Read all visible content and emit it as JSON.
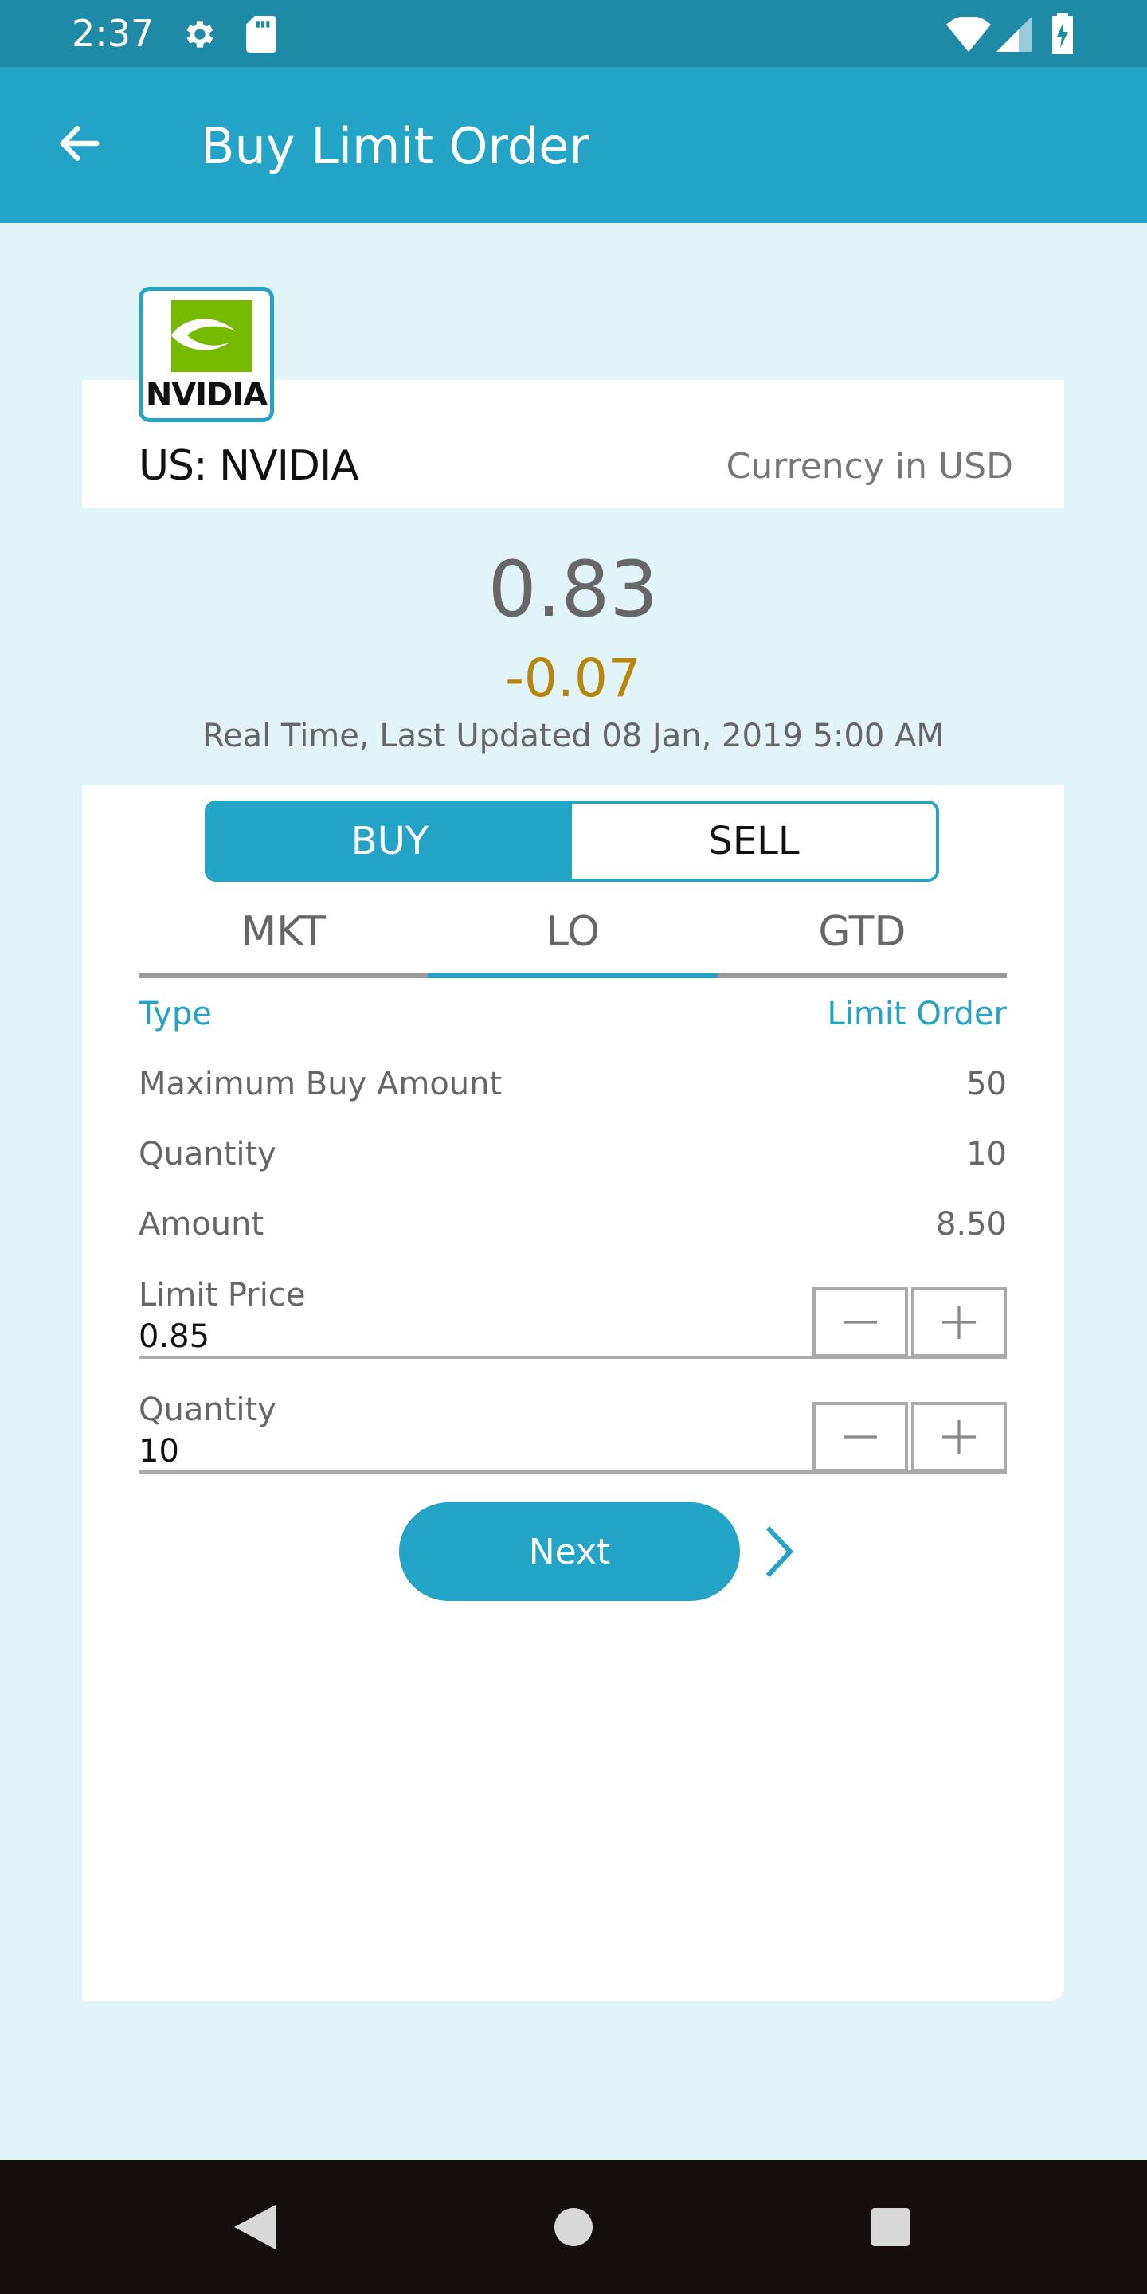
{
  "status": {
    "time": "2:37",
    "icons": [
      "gear-icon",
      "sd-card-icon",
      "wifi-icon",
      "signal-icon",
      "battery-charging-icon"
    ]
  },
  "appbar": {
    "title": "Buy Limit Order",
    "back_icon": "arrow-left-icon"
  },
  "stock": {
    "logo_text": "NVIDIA",
    "name": "US: NVIDIA",
    "currency": "Currency in USD",
    "price": "0.83",
    "change": "-0.07",
    "updated": "Real Time, Last Updated 08 Jan, 2019 5:00 AM"
  },
  "toggle": {
    "buy": "BUY",
    "sell": "SELL",
    "selected": "BUY"
  },
  "tabs": [
    {
      "label": "MKT",
      "active": false
    },
    {
      "label": "LO",
      "active": true
    },
    {
      "label": "GTD",
      "active": false
    }
  ],
  "details": {
    "type_label": "Type",
    "type_value": "Limit Order",
    "max_buy_label": "Maximum Buy Amount",
    "max_buy_value": "50",
    "quantity_label": "Quantity",
    "quantity_value": "10",
    "amount_label": "Amount",
    "amount_value": "8.50"
  },
  "fields": {
    "limit_price_label": "Limit Price",
    "limit_price_value": "0.85",
    "quantity_label": "Quantity",
    "quantity_value": "10"
  },
  "actions": {
    "next": "Next"
  },
  "colors": {
    "accent": "#23a3c6",
    "statusbar": "#1f8aa6",
    "background": "#e1f4f7",
    "change": "#b8860b",
    "navbar": "#140e0e"
  }
}
